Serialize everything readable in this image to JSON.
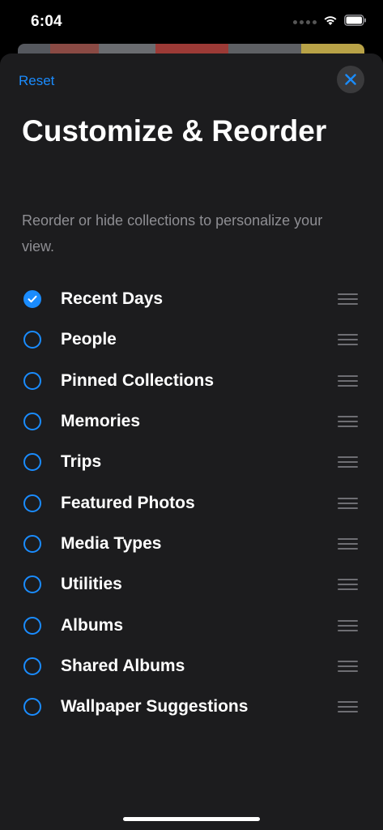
{
  "status_bar": {
    "time": "6:04",
    "icons": [
      "signal-icon",
      "wifi-icon",
      "battery-icon"
    ]
  },
  "colors": {
    "accent": "#1a8cff",
    "sheet_background": "#1c1c1e",
    "secondary_text": "#8e8e93"
  },
  "sheet": {
    "reset_label": "Reset",
    "close_icon": "close-icon",
    "title": "Customize & Reorder",
    "subtitle": "Reorder or hide collections to personalize your view."
  },
  "collections": [
    {
      "label": "Recent Days",
      "checked": true
    },
    {
      "label": "People",
      "checked": false
    },
    {
      "label": "Pinned Collections",
      "checked": false
    },
    {
      "label": "Memories",
      "checked": false
    },
    {
      "label": "Trips",
      "checked": false
    },
    {
      "label": "Featured Photos",
      "checked": false
    },
    {
      "label": "Media Types",
      "checked": false
    },
    {
      "label": "Utilities",
      "checked": false
    },
    {
      "label": "Albums",
      "checked": false
    },
    {
      "label": "Shared Albums",
      "checked": false
    },
    {
      "label": "Wallpaper Suggestions",
      "checked": false
    }
  ]
}
